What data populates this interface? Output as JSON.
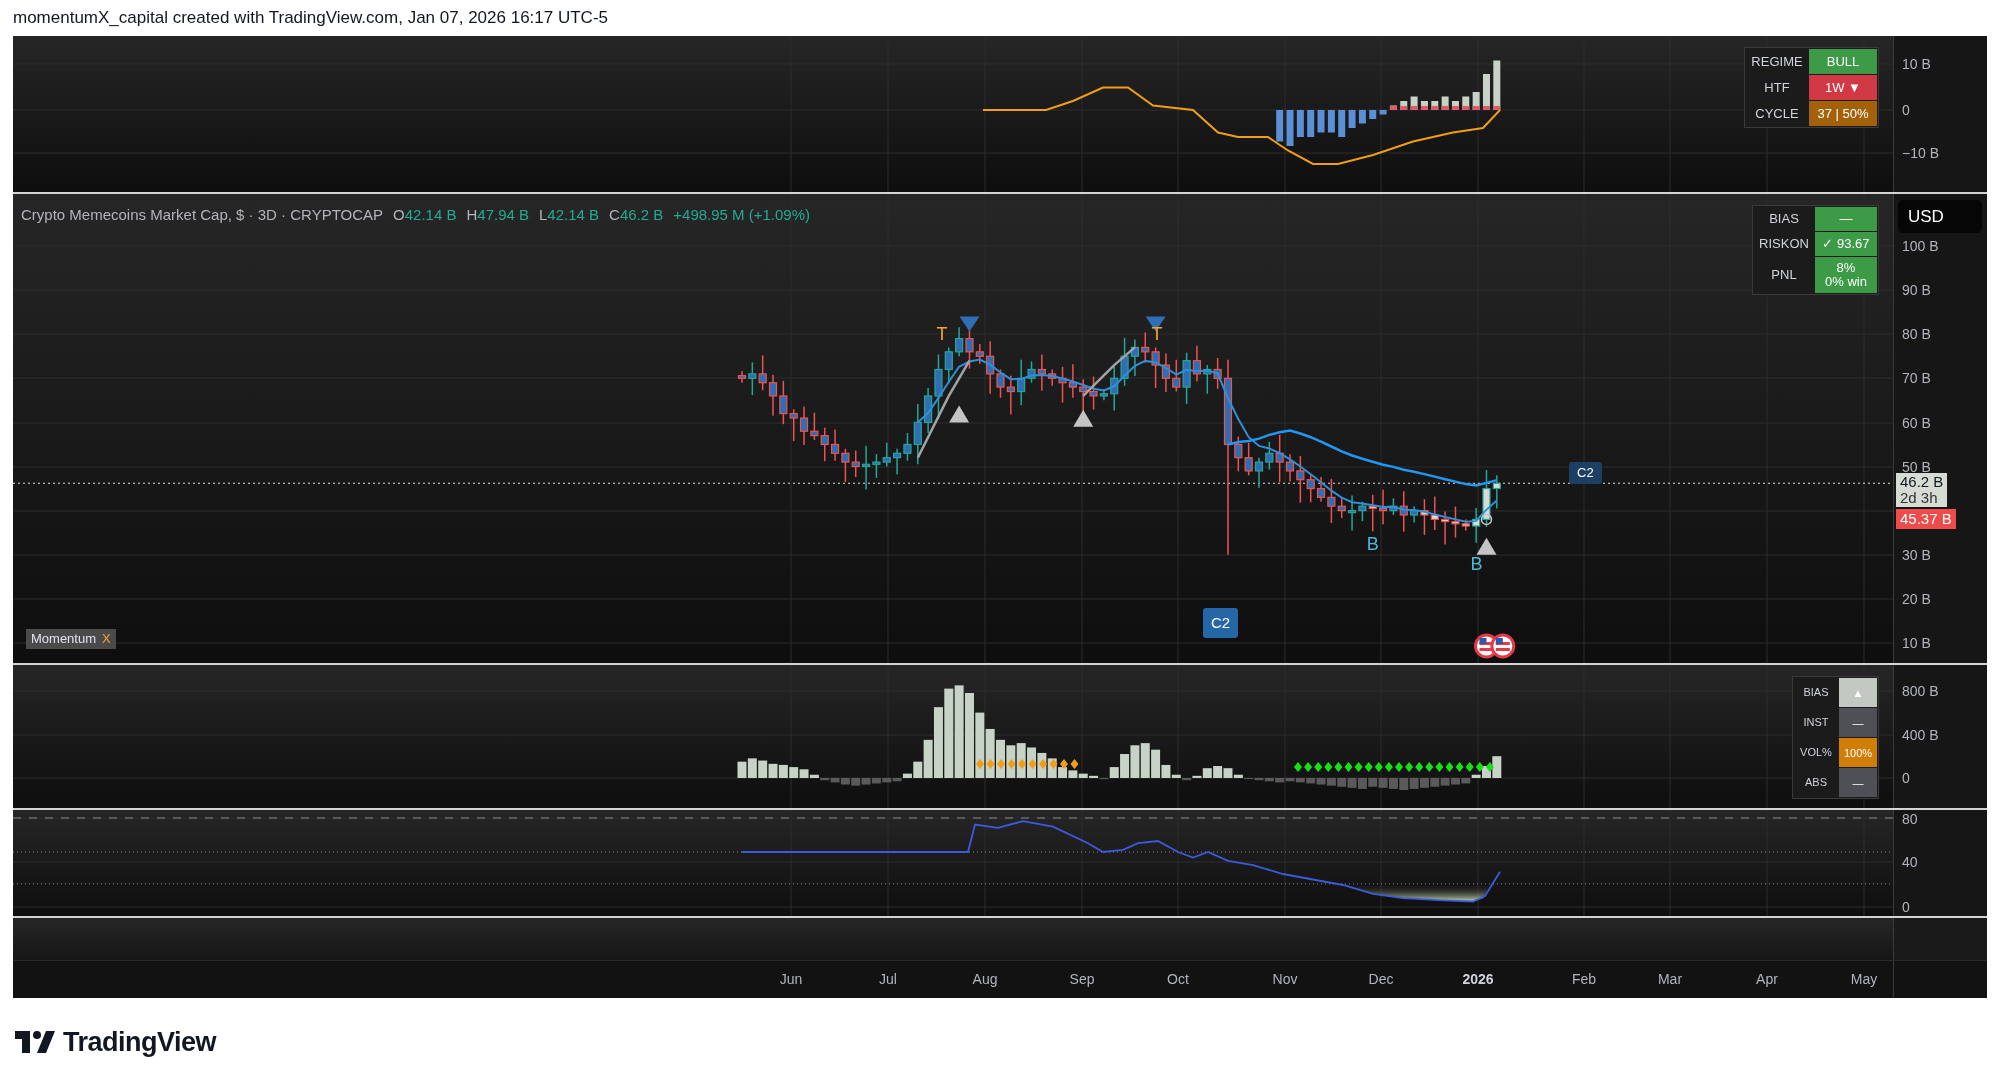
{
  "header": {
    "text": "momentumX_capital created with TradingView.com, Jan 07, 2026 16:17 UTC-5"
  },
  "regime_pane": {
    "table": [
      {
        "label": "REGIME",
        "value": "BULL",
        "color": "#3d9a47"
      },
      {
        "label": "HTF",
        "value": "1W ▼",
        "color": "#d13a45"
      },
      {
        "label": "CYCLE",
        "value": "37 | 50%",
        "color": "#a36209"
      }
    ],
    "axis": [
      "10 B",
      "0",
      "−10 B"
    ]
  },
  "price_pane": {
    "symbol": "Crypto Memecoins Market Cap, $ · 3D · CRYPTOCAP",
    "ohlc": [
      {
        "label": "O",
        "value": "42.14 B"
      },
      {
        "label": "H",
        "value": "47.94 B"
      },
      {
        "label": "L",
        "value": "42.14 B"
      },
      {
        "label": "C",
        "value": "46.2 B"
      }
    ],
    "change": "+498.95 M (+1.09%)",
    "table": [
      {
        "label": "BIAS",
        "value": "—",
        "color": "#3d9a47"
      },
      {
        "label": "RISKON",
        "value": "✓ 93.67",
        "color": "#3d9a47"
      },
      {
        "label": "PNL",
        "value": "8%",
        "value_2": "0% win",
        "color": "#3d9a47"
      }
    ],
    "currency": "USD",
    "axis": [
      "100 B",
      "90 B",
      "80 B",
      "70 B",
      "60 B",
      "50 B",
      "30 B",
      "20 B",
      "10 B"
    ],
    "last_price": "46.2 B",
    "countdown": "2d 3h",
    "level_price": "45.37 B",
    "signals": [
      {
        "kind": "top",
        "text": "T"
      },
      {
        "kind": "top",
        "text": "T"
      },
      {
        "kind": "buy",
        "text": "B"
      },
      {
        "kind": "buy",
        "text": "B"
      },
      {
        "kind": "cycle_below",
        "text": "C2"
      },
      {
        "kind": "cycle_right",
        "text": "C2"
      }
    ],
    "indicator": {
      "name": "Momentum",
      "close": "X"
    }
  },
  "volume_pane": {
    "table": [
      {
        "label": "BIAS",
        "value": "▲",
        "color": "#c3c8c3"
      },
      {
        "label": "INST",
        "value": "—",
        "color": "#4f5056"
      },
      {
        "label": "VOL%",
        "value": "100%",
        "color": "#d07e08"
      },
      {
        "label": "ABS",
        "value": "—",
        "color": "#4f5056"
      }
    ],
    "axis": [
      "800 B",
      "400 B",
      "0"
    ]
  },
  "oscillator_pane": {
    "axis": [
      "80",
      "40",
      "0"
    ]
  },
  "time_axis": [
    {
      "label": "Jun",
      "kind": "month"
    },
    {
      "label": "Jul",
      "kind": "month"
    },
    {
      "label": "Aug",
      "kind": "month"
    },
    {
      "label": "Sep",
      "kind": "month"
    },
    {
      "label": "Oct",
      "kind": "month"
    },
    {
      "label": "Nov",
      "kind": "month"
    },
    {
      "label": "Dec",
      "kind": "month"
    },
    {
      "label": "2026",
      "kind": "year"
    },
    {
      "label": "Feb",
      "kind": "month"
    },
    {
      "label": "Mar",
      "kind": "month"
    },
    {
      "label": "Apr",
      "kind": "month"
    },
    {
      "label": "May",
      "kind": "month"
    }
  ],
  "footer": {
    "logo": "TradingView"
  }
}
